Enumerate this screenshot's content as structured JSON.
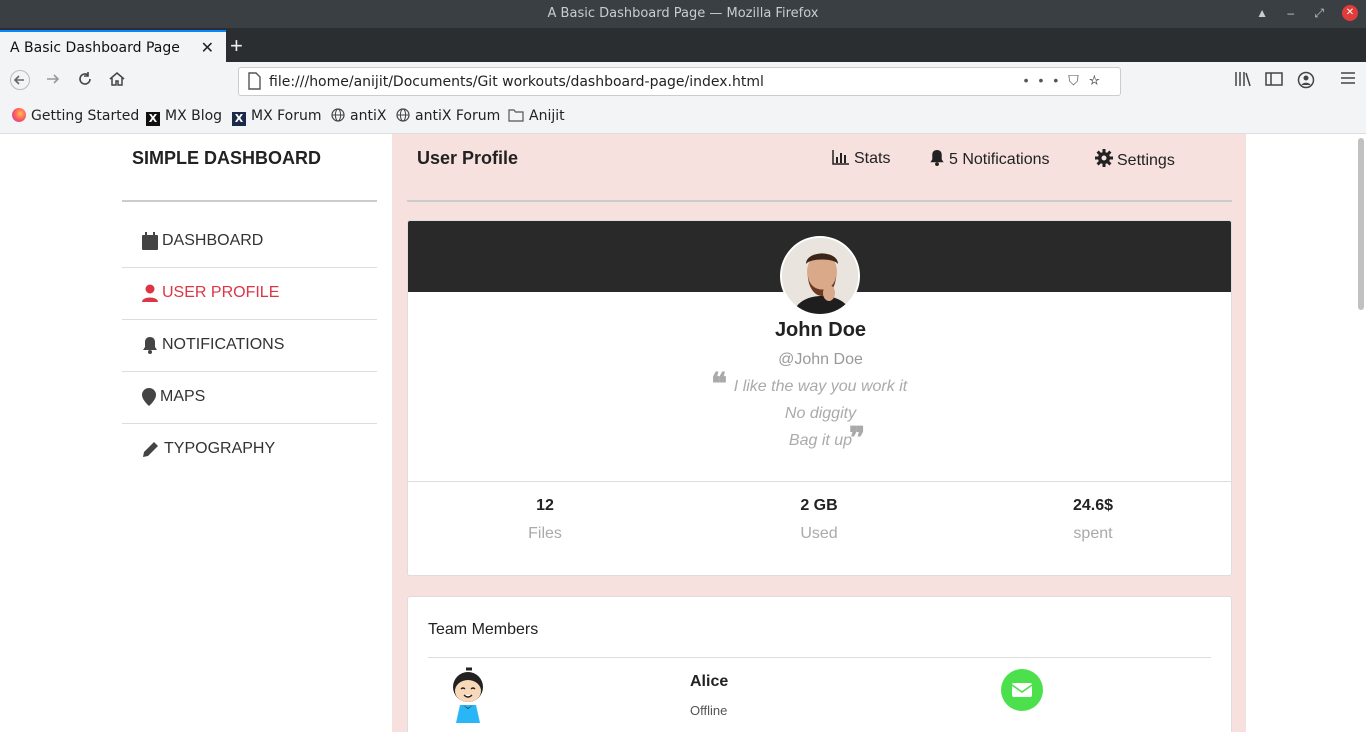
{
  "window": {
    "title": "A Basic Dashboard Page — Mozilla Firefox"
  },
  "tab": {
    "label": "A Basic Dashboard Page",
    "close": "✕",
    "new_tab": "+"
  },
  "urlbar": {
    "url": "file:///home/anijit/Documents/Git workouts/dashboard-page/index.html"
  },
  "bookmarks": [
    {
      "label": "Getting Started",
      "icon": "firefox-icon"
    },
    {
      "label": "MX Blog",
      "icon": "mx-icon"
    },
    {
      "label": "MX Forum",
      "icon": "mx-icon"
    },
    {
      "label": "antiX",
      "icon": "globe-icon"
    },
    {
      "label": "antiX Forum",
      "icon": "globe-icon"
    },
    {
      "label": "Anijit",
      "icon": "folder-icon"
    }
  ],
  "sidebar": {
    "brand": "SIMPLE DASHBOARD",
    "items": [
      {
        "label": "DASHBOARD",
        "icon": "calendar-icon",
        "active": false
      },
      {
        "label": "USER PROFILE",
        "icon": "user-icon",
        "active": true
      },
      {
        "label": "NOTIFICATIONS",
        "icon": "bell-icon",
        "active": false
      },
      {
        "label": "MAPS",
        "icon": "map-marker-icon",
        "active": false
      },
      {
        "label": "TYPOGRAPHY",
        "icon": "pencil-icon",
        "active": false
      }
    ]
  },
  "header": {
    "title": "User Profile",
    "stats": "Stats",
    "notifications": "5 Notifications",
    "settings": "Settings"
  },
  "profile": {
    "name": "John Doe",
    "handle": "@John Doe",
    "quote_lines": [
      "I like the way you work it",
      "No diggity",
      "Bag it up"
    ],
    "stats": [
      {
        "value": "12",
        "label": "Files"
      },
      {
        "value": "2 GB",
        "label": "Used"
      },
      {
        "value": "24.6$",
        "label": "spent"
      }
    ]
  },
  "team": {
    "title": "Team Members",
    "members": [
      {
        "name": "Alice",
        "status": "Offline"
      }
    ]
  },
  "colors": {
    "active": "#dc3545",
    "main_bg": "#f6e1df",
    "banner": "#292929",
    "mail": "#4de04d"
  }
}
